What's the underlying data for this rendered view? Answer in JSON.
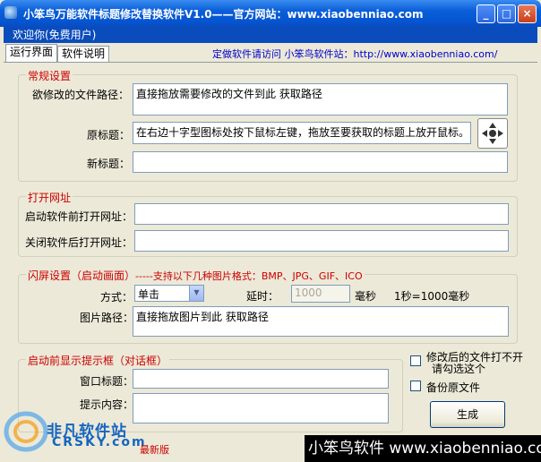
{
  "window": {
    "title": "小笨鸟万能软件标题修改替换软件V1.0——官方网站：www.xiaobenniao.com",
    "minimize": "_",
    "maximize": "□",
    "close": "×"
  },
  "welcome": "欢迎你(免费用户)",
  "tabs": [
    {
      "label": "运行界面",
      "active": true
    },
    {
      "label": "软件说明",
      "active": false
    }
  ],
  "site_link": "定做软件请访问  小笨鸟软件站：http://www.xiaobenniao.com/",
  "general": {
    "title": "常规设置",
    "path_label": "欲修改的文件路径：",
    "path_value": "直接拖放需要修改的文件到此 获取路径",
    "orig_title_label": "原标题：",
    "orig_title_value": "在右边十字型图标处按下鼠标左键，拖放至要获取的标题上放开鼠标。",
    "new_title_label": "新标题：",
    "new_title_value": ""
  },
  "open_url": {
    "title": "打开网址",
    "before_label": "启动软件前打开网址：",
    "before_value": "",
    "after_label": "关闭软件后打开网址：",
    "after_value": ""
  },
  "splash": {
    "title": "闪屏设置（启动画面）",
    "formats": "-----支持以下几种图片格式：BMP、JPG、GIF、ICO",
    "mode_label": "方式：",
    "mode_value": "单击",
    "delay_label": "延时：",
    "delay_value": "1000",
    "delay_unit": "毫秒",
    "delay_note": "1秒=1000毫秒",
    "image_label": "图片路径：",
    "image_value": "直接拖放图片到此 获取路径"
  },
  "prompt": {
    "title": "启动前显示提示框（对话框）",
    "window_title_label": "窗口标题：",
    "window_title_value": "",
    "content_label": "提示内容：",
    "content_value": ""
  },
  "options": {
    "chk_untouched": "修改后的文件打不开请勾选这个",
    "chk_untouched_line1": "修改后的文件打不开",
    "chk_untouched_line2": "请勾选这个",
    "chk_backup": "备份原文件"
  },
  "generate_button": "生成",
  "footer": {
    "right": "小笨鸟软件 www.xiaobenniao.com",
    "watermark": "非凡软件站",
    "watermark_sub": "CRSKY.com",
    "watermark_red": "最新版"
  },
  "colors": {
    "title_blue": "#0553d0",
    "group_title_red": "#cc0000",
    "link_blue": "#0000cc",
    "window_bg": "#ece9d8"
  }
}
